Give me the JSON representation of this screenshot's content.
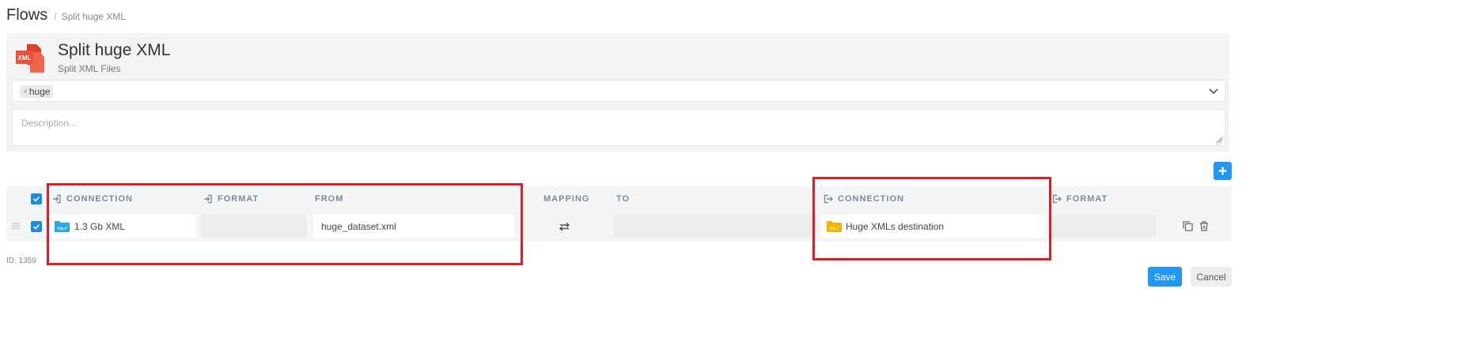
{
  "breadcrumb": {
    "root": "Flows",
    "separator": "/",
    "current": "Split huge XML"
  },
  "flow": {
    "title": "Split huge XML",
    "subtitle": "Split XML Files",
    "icon": "xml-file-icon"
  },
  "tags": {
    "items": [
      "huge"
    ]
  },
  "description": {
    "placeholder": "Description..."
  },
  "table": {
    "headers": {
      "source_connection": "CONNECTION",
      "source_format": "FORMAT",
      "from": "FROM",
      "mapping": "MAPPING",
      "to": "TO",
      "dest_connection": "CONNECTION",
      "dest_format": "FORMAT"
    },
    "rows": [
      {
        "source_connection": "1.3 Gb XML",
        "source_connection_icon": "http-folder-icon",
        "source_format": "",
        "from": "huge_dataset.xml",
        "mapping_icon": "swap-arrows-icon",
        "to": "",
        "dest_connection": "Huge XMLs destination",
        "dest_connection_icon": "file-folder-icon",
        "dest_format": ""
      }
    ]
  },
  "footer": {
    "id_label": "ID: 1359",
    "save_label": "Save",
    "cancel_label": "Cancel"
  },
  "colors": {
    "accent": "#2196f3",
    "highlight": "#e31c23",
    "xml_icon": "#e8523a",
    "http_folder": "#29a9e1",
    "file_folder": "#f5b400"
  }
}
